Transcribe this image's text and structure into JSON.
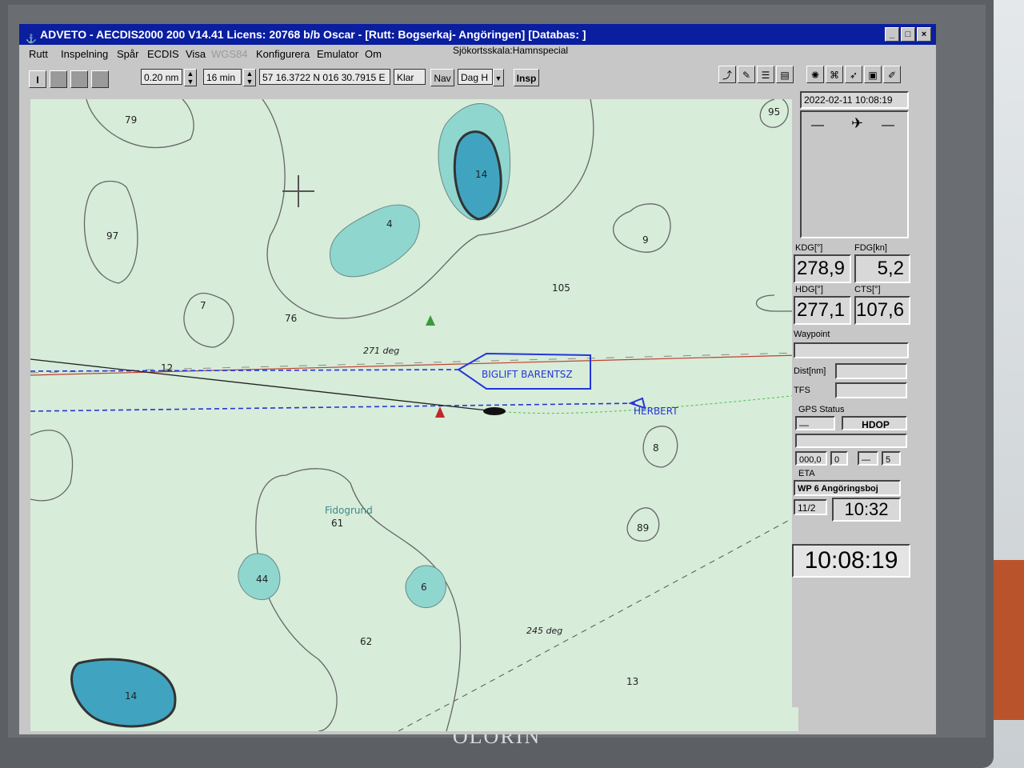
{
  "window": {
    "title": "ADVETO - AECDIS2000 200 V14.41  Licens: 20768 b/b Oscar - [Rutt: Bogserkaj- Angöringen] [Databas: ]",
    "controls": [
      "_",
      "□",
      "×"
    ]
  },
  "menu": {
    "items": [
      "Rutt",
      "Inspelning",
      "Spår",
      "ECDIS",
      "Visa",
      "WGS84",
      "Konfigurera",
      "Emulator",
      "Om"
    ],
    "scale_label": "Sjökortsskala:Hamnspecial"
  },
  "toolbar": {
    "range": "0.20 nm",
    "time": "16 min",
    "position": "57 16.3722 N  016 30.7915 E",
    "status": "Klar",
    "nav": "Nav",
    "mode": "Dag H",
    "insp": "Insp"
  },
  "panel": {
    "datetime": "2022-02-11 10:08:19",
    "kdg_label": "KDG[°]",
    "kdg_value": "278,9",
    "fdg_label": "FDG[kn]",
    "fdg_value": "5,2",
    "hdg_label": "HDG[°]",
    "hdg_value": "277,1",
    "cts_label": "CTS[°]",
    "cts_value": "107,6",
    "waypoint_label": "Waypoint",
    "dist_label": "Dist[nm]",
    "tfs_label": "TFS",
    "gps_label": "GPS Status",
    "hdop_label": "HDOP",
    "gps_values": [
      "000,0",
      "0",
      "5"
    ],
    "eta_label": "ETA",
    "eta_wp": "WP 6  Angöringsboj",
    "eta_date": "11/2",
    "eta_time": "10:32",
    "clock": "10:08:19"
  },
  "chart": {
    "depths": [
      "79",
      "97",
      "14",
      "4",
      "9",
      "95",
      "105",
      "7",
      "76",
      "12",
      "8",
      "89",
      "61",
      "44",
      "6",
      "62",
      "14",
      "13"
    ],
    "place_name": "Fidogrund",
    "heading_1": "271 deg",
    "heading_2": "245 deg",
    "vessel_1": "BIGLIFT BARENTSZ",
    "vessel_2": "HERBERT"
  },
  "bezel": {
    "brand": "OLÓRIN"
  },
  "colors": {
    "title_blue": "#0a1ea0",
    "chart_shallow": "#8fd6cf",
    "chart_deep": "#40a4c0",
    "chart_background": "#d7ecd9",
    "ais_blue": "#2535d8"
  }
}
